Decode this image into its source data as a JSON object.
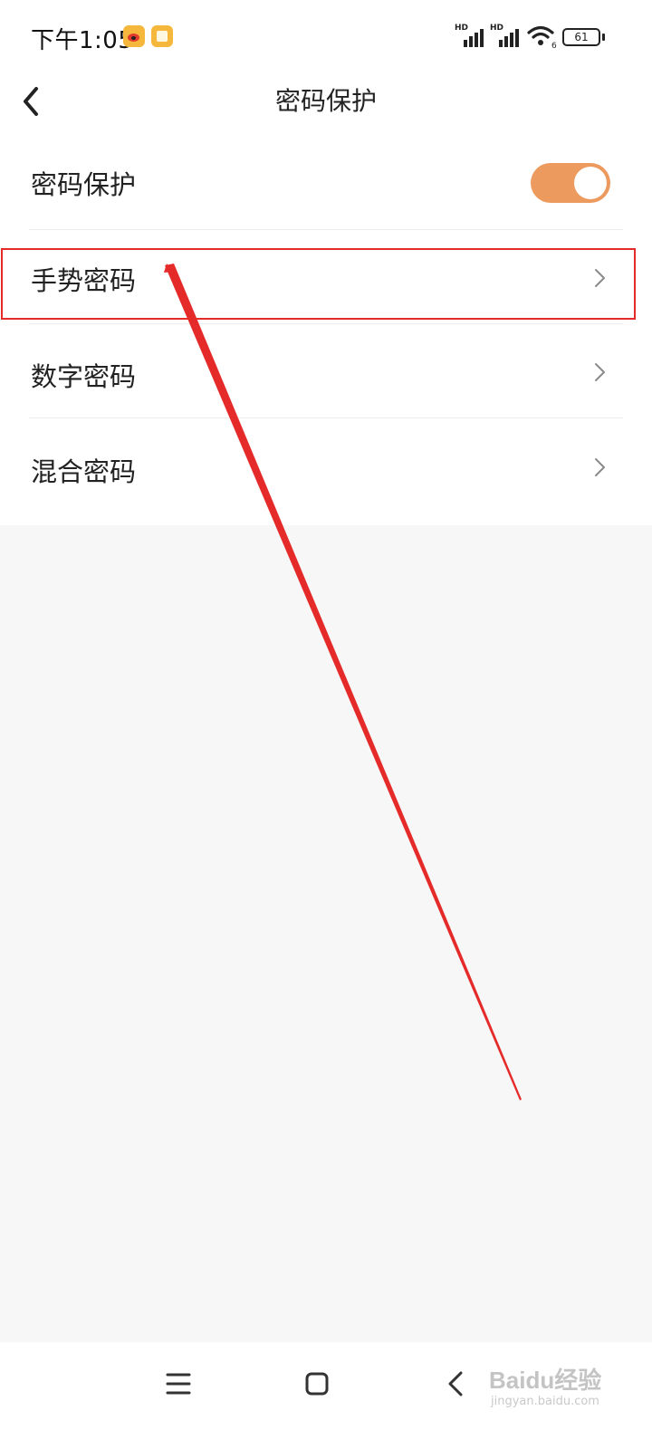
{
  "status_bar": {
    "time": "下午1:05",
    "signal_labels": [
      "HD",
      "HD"
    ],
    "battery": "61",
    "wifi_sub": "6"
  },
  "header": {
    "title": "密码保护",
    "back_icon": "chevron-left-icon"
  },
  "settings": {
    "toggle_row": {
      "label": "密码保护",
      "toggle_on": true,
      "accent_color": "#ec9a5d"
    },
    "items": [
      {
        "label": "手势密码",
        "highlighted": true
      },
      {
        "label": "数字密码",
        "highlighted": false
      },
      {
        "label": "混合密码",
        "highlighted": false
      }
    ]
  },
  "annotation": {
    "color": "#e52a2a"
  },
  "nav_bar": {
    "buttons": [
      "menu-icon",
      "home-icon",
      "back-icon"
    ]
  },
  "watermark": {
    "main": "Baidu经验",
    "sub": "jingyan.baidu.com"
  }
}
